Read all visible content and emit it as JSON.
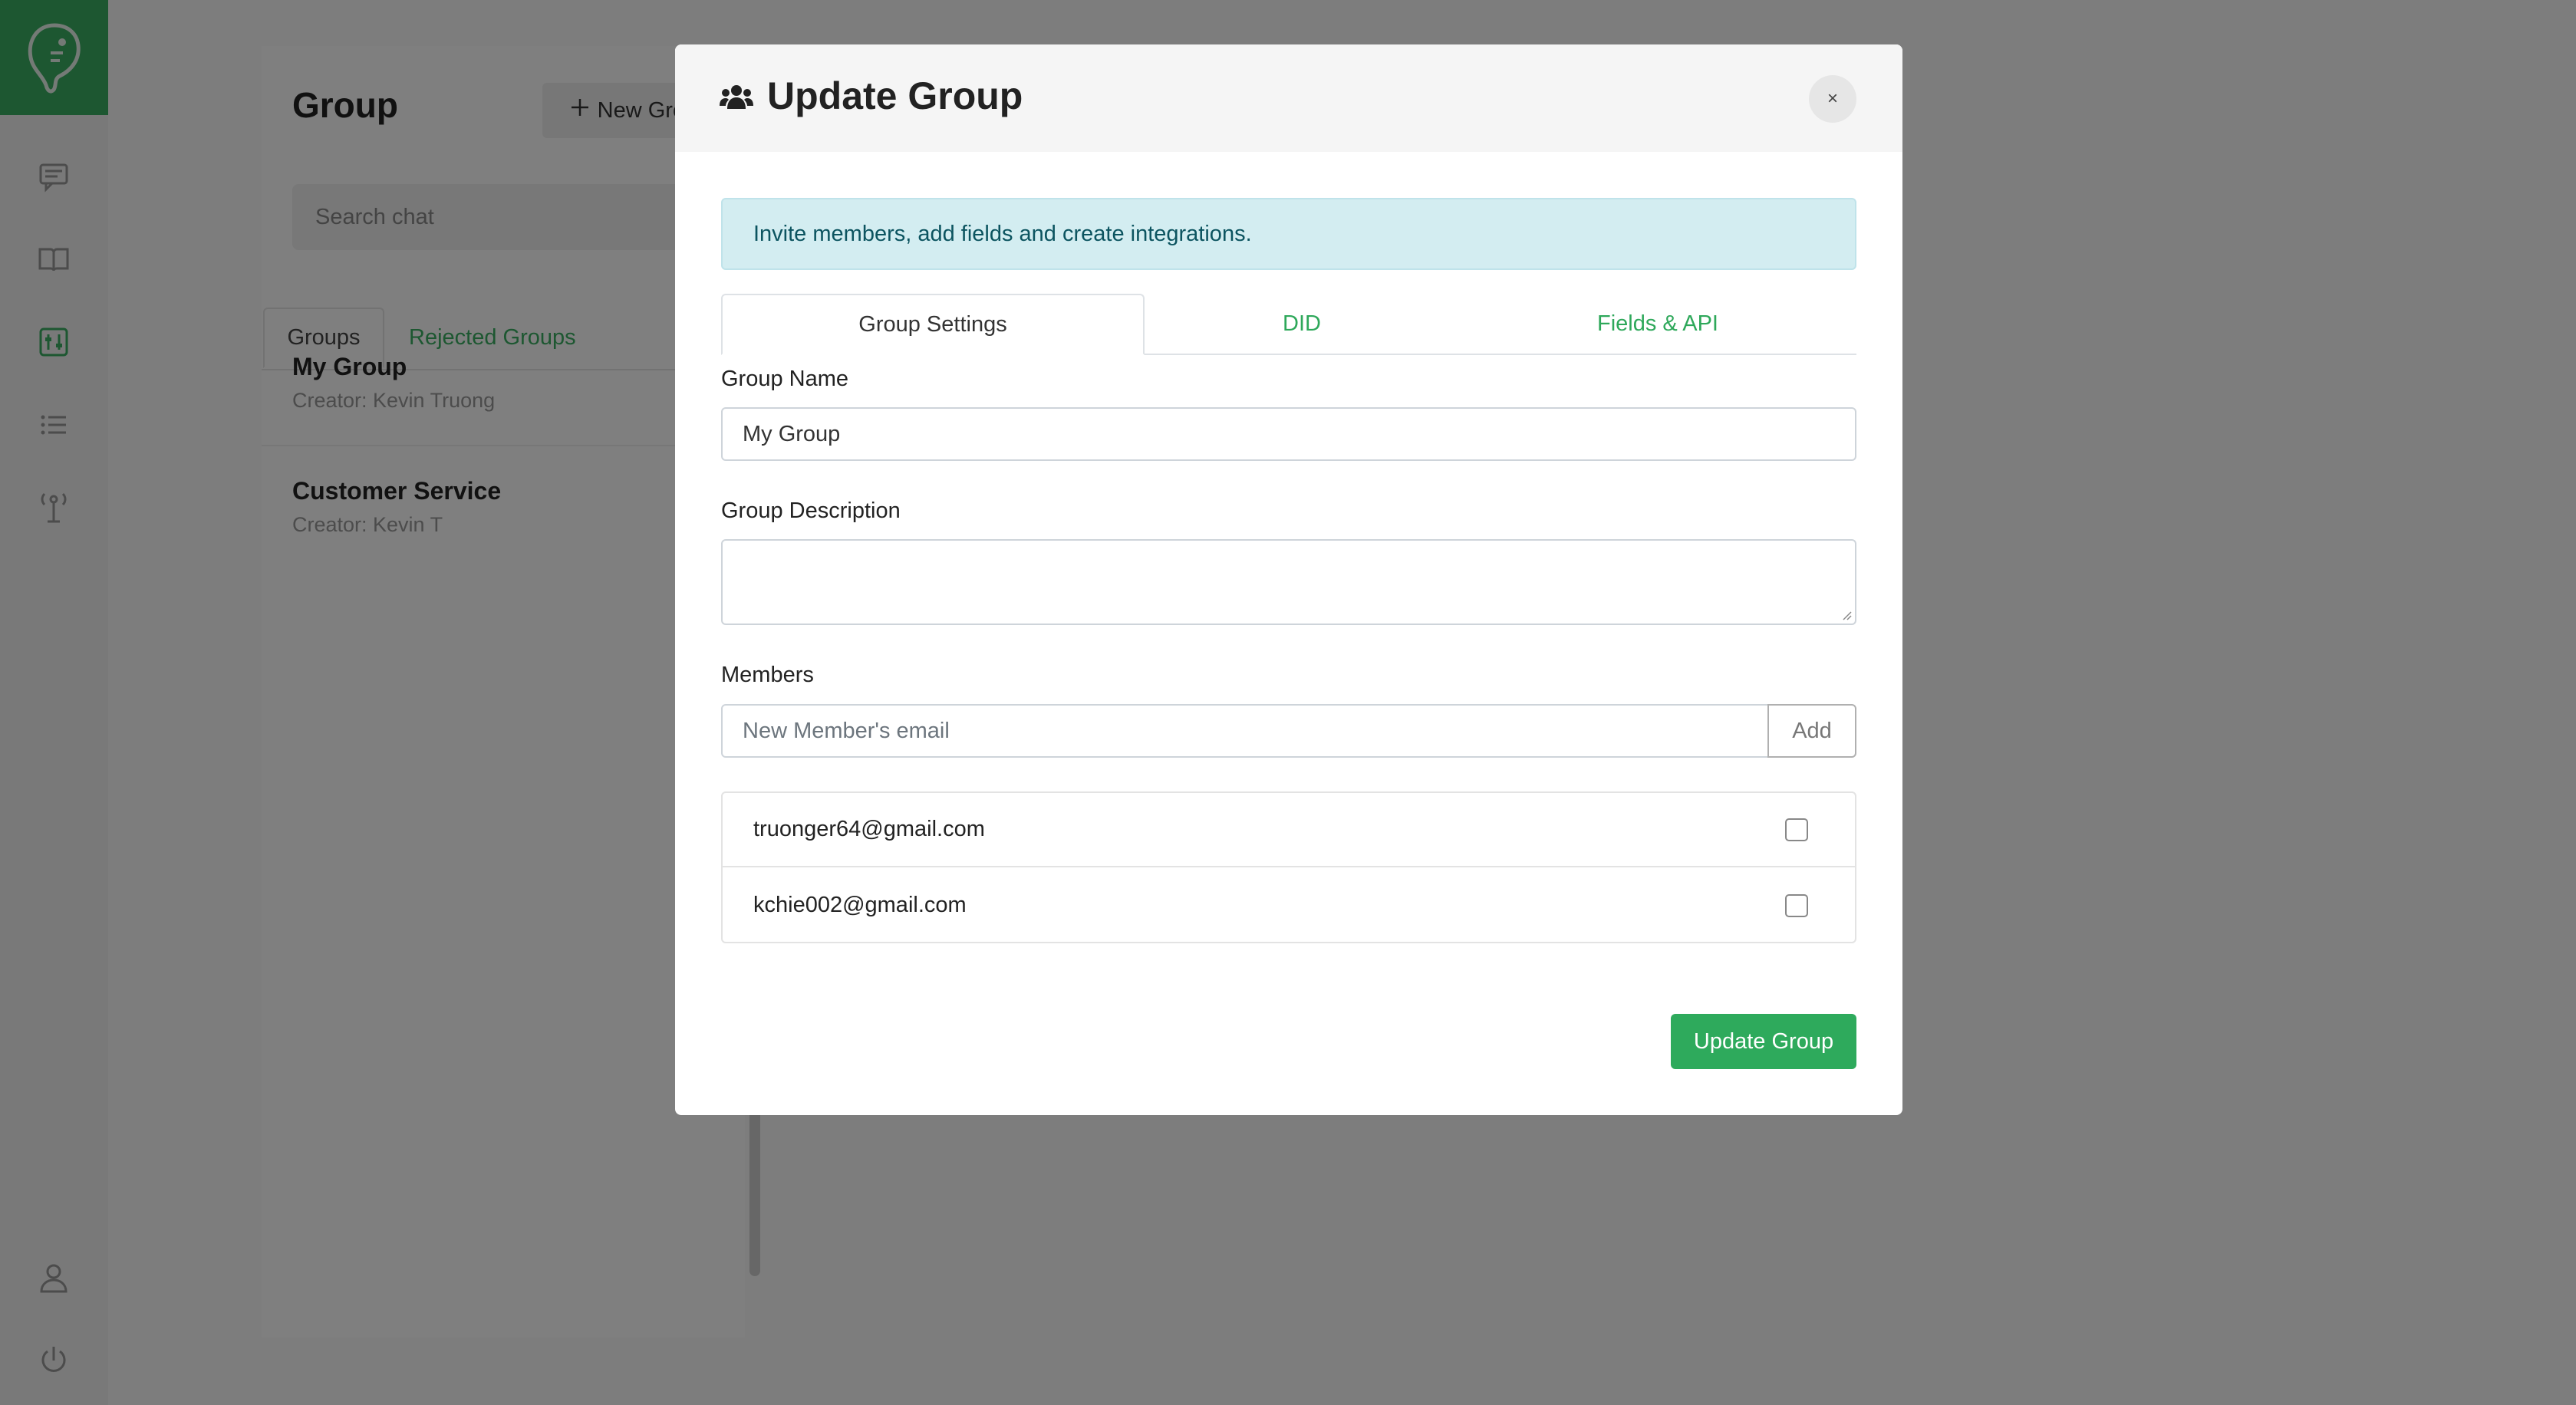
{
  "colors": {
    "brand_green": "#3aae62",
    "link_green": "#2ea85a",
    "info_bg": "#d3edf1",
    "overlay": "rgba(0,0,0,0.5)"
  },
  "nav_rail": {
    "items": [
      {
        "icon": "logo-icon"
      },
      {
        "icon": "chat-icon"
      },
      {
        "icon": "book-icon"
      },
      {
        "icon": "settings-sliders-icon"
      },
      {
        "icon": "list-icon"
      },
      {
        "icon": "antenna-icon"
      },
      {
        "icon": "user-icon"
      },
      {
        "icon": "power-icon"
      }
    ]
  },
  "group_panel": {
    "title": "Group",
    "new_group_label": "New Group",
    "search_placeholder": "Search chat",
    "tabs": [
      {
        "label": "Groups",
        "active": true
      },
      {
        "label": "Rejected Groups",
        "active": false
      }
    ],
    "groups": [
      {
        "name": "My Group",
        "creator": "Creator: Kevin Truong"
      },
      {
        "name": "Customer Service",
        "creator": "Creator: Kevin T"
      }
    ]
  },
  "modal": {
    "title": "Update Group",
    "title_icon": "users-icon",
    "close_label": "×",
    "info_text": "Invite members, add fields and create integrations.",
    "tabs": [
      {
        "label": "Group Settings",
        "active": true
      },
      {
        "label": "DID",
        "active": false
      },
      {
        "label": "Fields & API",
        "active": false
      }
    ],
    "group_name_label": "Group Name",
    "group_name_value": "My Group",
    "group_description_label": "Group Description",
    "group_description_value": "",
    "members_label": "Members",
    "member_email_placeholder": "New Member's email",
    "add_label": "Add",
    "members": [
      {
        "email": "truonger64@gmail.com",
        "checked": false
      },
      {
        "email": "kchie002@gmail.com",
        "checked": false
      }
    ],
    "submit_label": "Update Group"
  }
}
